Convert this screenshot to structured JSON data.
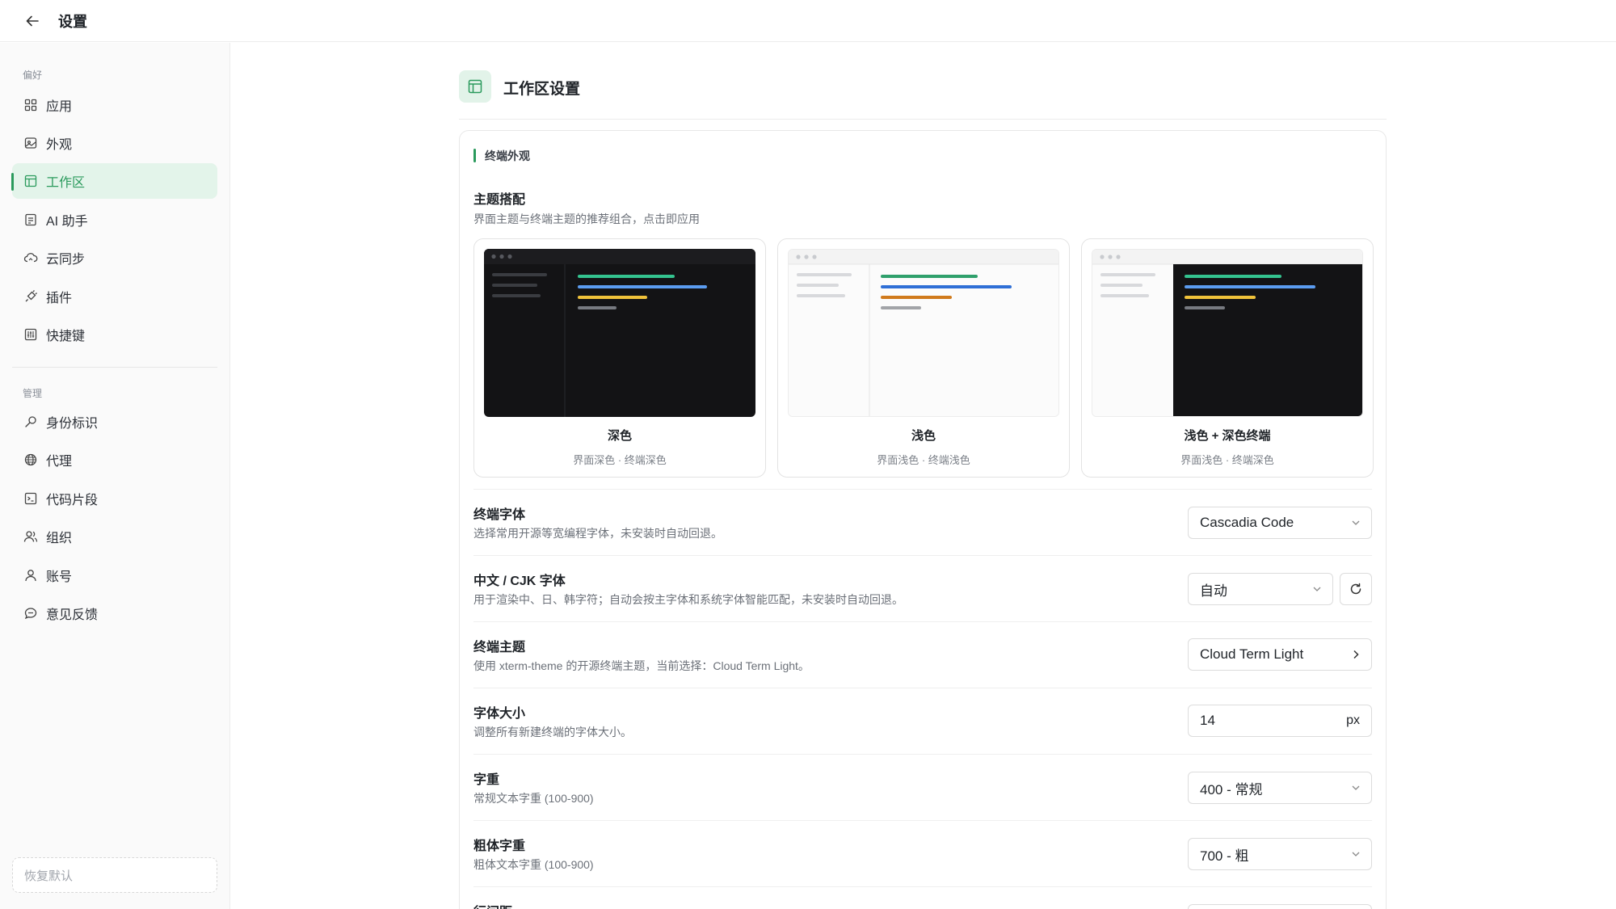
{
  "topbar": {
    "title": "设置"
  },
  "sidebar": {
    "group_preferences": "偏好",
    "group_manage": "管理",
    "items": [
      {
        "label": "应用",
        "icon": "grid-icon"
      },
      {
        "label": "外观",
        "icon": "palette-icon"
      },
      {
        "label": "工作区",
        "icon": "layout-icon",
        "active": true
      },
      {
        "label": "AI 助手",
        "icon": "bot-icon"
      },
      {
        "label": "云同步",
        "icon": "cloud-sync-icon"
      },
      {
        "label": "插件",
        "icon": "plug-icon"
      },
      {
        "label": "快捷键",
        "icon": "keyboard-icon"
      },
      {
        "label": "身份标识",
        "icon": "key-icon"
      },
      {
        "label": "代理",
        "icon": "globe-icon"
      },
      {
        "label": "代码片段",
        "icon": "terminal-icon"
      },
      {
        "label": "组织",
        "icon": "users-icon"
      },
      {
        "label": "账号",
        "icon": "user-icon"
      },
      {
        "label": "意见反馈",
        "icon": "message-icon"
      }
    ],
    "restore_label": "恢复默认"
  },
  "main": {
    "title": "工作区设置",
    "section": "终端外观",
    "combo": {
      "title": "主题搭配",
      "desc": "界面主题与终端主题的推荐组合，点击即应用",
      "cards": [
        {
          "name": "深色",
          "sub": "界面深色 · 终端深色"
        },
        {
          "name": "浅色",
          "sub": "界面浅色 · 终端浅色"
        },
        {
          "name": "浅色 + 深色终端",
          "sub": "界面浅色 · 终端深色"
        }
      ]
    },
    "rows": {
      "font": {
        "title": "终端字体",
        "desc": "选择常用开源等宽编程字体，未安装时自动回退。",
        "value": "Cascadia Code"
      },
      "cjk": {
        "title": "中文 / CJK 字体",
        "desc": "用于渲染中、日、韩字符；自动会按主字体和系统字体智能匹配，未安装时自动回退。",
        "value": "自动"
      },
      "theme": {
        "title": "终端主题",
        "desc": "使用 xterm-theme 的开源终端主题，当前选择：Cloud Term Light。",
        "value": "Cloud Term Light"
      },
      "size": {
        "title": "字体大小",
        "desc": "调整所有新建终端的字体大小。",
        "value": "14",
        "unit": "px"
      },
      "weight": {
        "title": "字重",
        "desc": "常规文本字重 (100-900)",
        "value": "400 - 常规"
      },
      "bold": {
        "title": "粗体字重",
        "desc": "粗体文本字重 (100-900)",
        "value": "700 - 粗"
      },
      "line_height": {
        "title": "行间距"
      }
    }
  },
  "colors": {
    "accent": "#2a9a5c",
    "accent_bg": "#e3f4ea",
    "dark_terminal": "#131315"
  }
}
